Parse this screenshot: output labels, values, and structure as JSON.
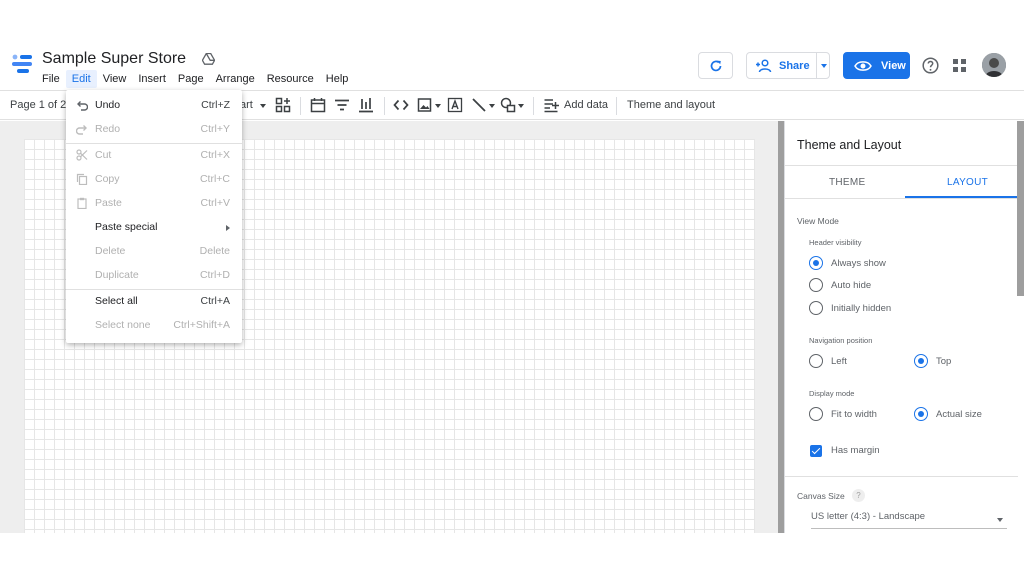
{
  "app": {
    "title": "Sample Super Store"
  },
  "menubar": {
    "items": [
      "File",
      "Edit",
      "View",
      "Insert",
      "Page",
      "Arrange",
      "Resource",
      "Help"
    ],
    "active": "Edit"
  },
  "header": {
    "share_label": "Share",
    "view_label": "View"
  },
  "toolbar": {
    "page_info": "Page 1 of 2",
    "chart_partial": "art",
    "add_data_label": "Add data",
    "theme_layout_label": "Theme and layout"
  },
  "edit_menu": {
    "items": [
      {
        "label": "Undo",
        "shortcut": "Ctrl+Z",
        "enabled": true,
        "icon": "undo-icon"
      },
      {
        "label": "Redo",
        "shortcut": "Ctrl+Y",
        "enabled": false,
        "icon": "redo-icon"
      },
      {
        "label": "Cut",
        "shortcut": "Ctrl+X",
        "enabled": false,
        "icon": "scissors-icon"
      },
      {
        "label": "Copy",
        "shortcut": "Ctrl+C",
        "enabled": false,
        "icon": "copy-icon"
      },
      {
        "label": "Paste",
        "shortcut": "Ctrl+V",
        "enabled": false,
        "icon": "clipboard-icon"
      },
      {
        "label": "Paste special",
        "shortcut": "",
        "enabled": true,
        "icon": ""
      },
      {
        "label": "Delete",
        "shortcut": "Delete",
        "enabled": false,
        "icon": ""
      },
      {
        "label": "Duplicate",
        "shortcut": "Ctrl+D",
        "enabled": false,
        "icon": ""
      },
      {
        "label": "Select all",
        "shortcut": "Ctrl+A",
        "enabled": true,
        "icon": ""
      },
      {
        "label": "Select none",
        "shortcut": "Ctrl+Shift+A",
        "enabled": false,
        "icon": ""
      }
    ]
  },
  "panel": {
    "title": "Theme and Layout",
    "tabs": [
      "THEME",
      "LAYOUT"
    ],
    "active_tab": "LAYOUT",
    "view_mode_label": "View Mode",
    "header_visibility": {
      "label": "Header visibility",
      "options": [
        "Always show",
        "Auto hide",
        "Initially hidden"
      ],
      "selected": "Always show"
    },
    "navigation_position": {
      "label": "Navigation position",
      "options": [
        "Left",
        "Top"
      ],
      "selected": "Top"
    },
    "display_mode": {
      "label": "Display mode",
      "options": [
        "Fit to width",
        "Actual size"
      ],
      "selected": "Actual size"
    },
    "has_margin": {
      "label": "Has margin",
      "checked": true
    },
    "canvas_size": {
      "label": "Canvas Size",
      "help": "?",
      "value": "US letter (4:3) - Landscape"
    }
  },
  "colors": {
    "accent": "#1a73e8",
    "menu_active_bg": "#e8f0fe",
    "canvas_bg": "#eeeeee"
  }
}
